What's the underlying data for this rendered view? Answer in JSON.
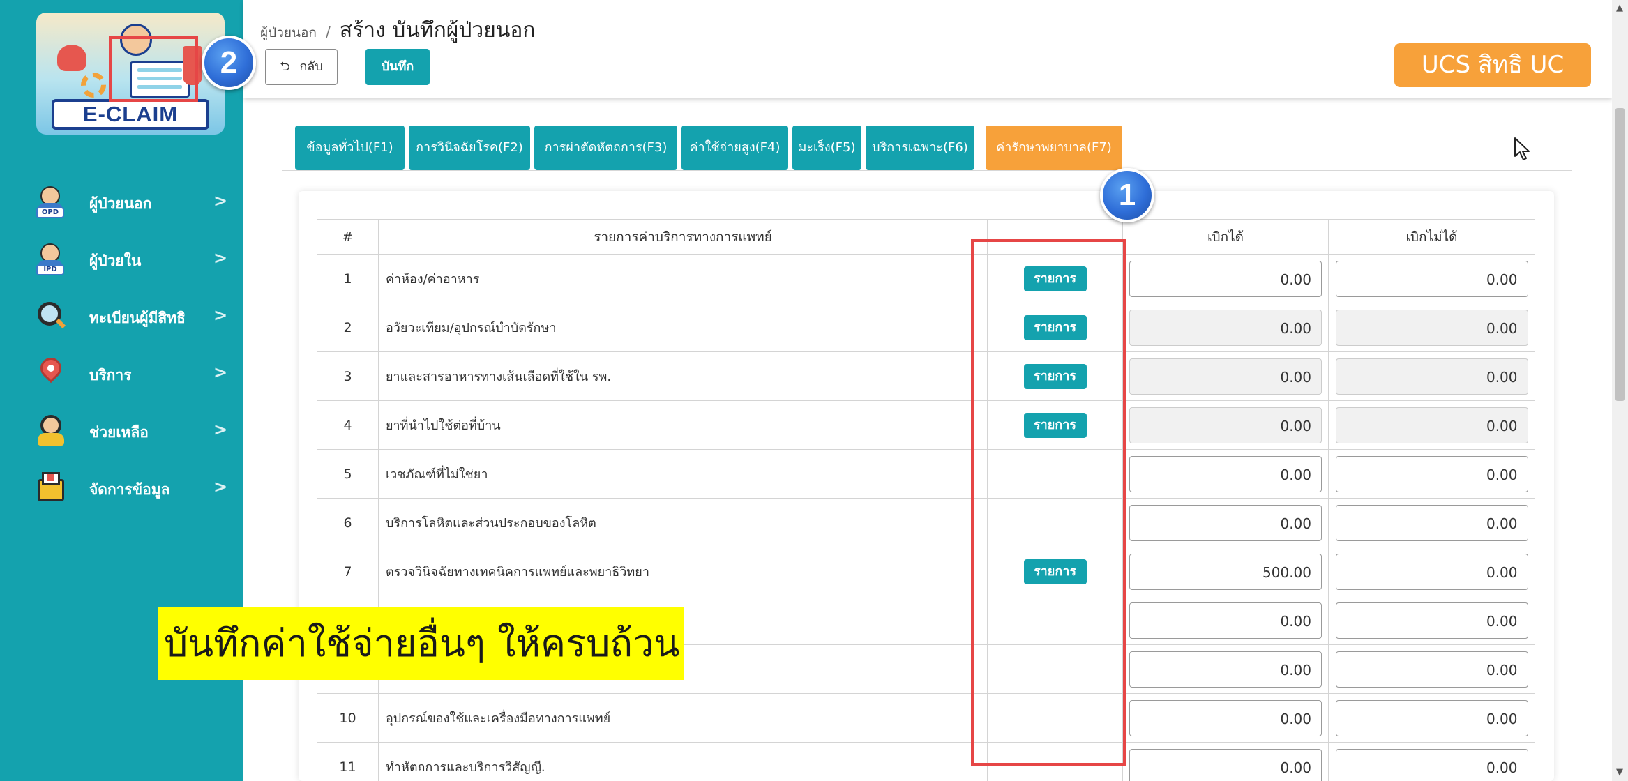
{
  "app": {
    "logo_text": "E-CLAIM"
  },
  "sidebar": {
    "items": [
      {
        "label": "ผู้ป่วยนอก",
        "icon": "opd-patient-icon",
        "icon_tag": "OPD"
      },
      {
        "label": "ผู้ป่วยใน",
        "icon": "ipd-patient-icon",
        "icon_tag": "IPD"
      },
      {
        "label": "ทะเบียนผู้มีสิทธิ",
        "icon": "registry-search-icon"
      },
      {
        "label": "บริการ",
        "icon": "location-pin-icon"
      },
      {
        "label": "ช่วยเหลือ",
        "icon": "support-agent-icon"
      },
      {
        "label": "จัดการข้อมูล",
        "icon": "data-manage-icon"
      }
    ],
    "chevron": ">"
  },
  "header": {
    "breadcrumb_parent": "ผู้ป่วยนอก",
    "breadcrumb_sep": "/",
    "title": "สร้าง บันทึกผู้ป่วยนอก",
    "back_label": "กลับ",
    "save_label": "บันทึก",
    "right_label": "UCS สิทธิ UC"
  },
  "tabs": [
    {
      "label": "ข้อมูลทั่วไป(F1)",
      "active": false
    },
    {
      "label": "การวินิจฉัยโรค(F2)",
      "active": false
    },
    {
      "label": "การผ่าตัดหัตถการ(F3)",
      "active": false
    },
    {
      "label": "ค่าใช้จ่ายสูง(F4)",
      "active": false
    },
    {
      "label": "มะเร็ง(F5)",
      "active": false
    },
    {
      "label": "บริการเฉพาะ(F6)",
      "active": false
    },
    {
      "label": "ค่ารักษาพยาบาล(F7)",
      "active": true
    }
  ],
  "table": {
    "headers": [
      "#",
      "รายการค่าบริการทางการแพทย์",
      "",
      "เบิกได้",
      "เบิกไม่ได้"
    ],
    "rows": [
      {
        "no": "1",
        "name": "ค่าห้อง/ค่าอาหาร",
        "button": "รายการ",
        "claimable": "0.00",
        "non_claimable": "0.00",
        "readonly": false
      },
      {
        "no": "2",
        "name": "อวัยวะเทียม/อุปกรณ์บำบัดรักษา",
        "button": "รายการ",
        "claimable": "0.00",
        "non_claimable": "0.00",
        "readonly": true
      },
      {
        "no": "3",
        "name": "ยาและสารอาหารทางเส้นเลือดที่ใช้ใน รพ.",
        "button": "รายการ",
        "claimable": "0.00",
        "non_claimable": "0.00",
        "readonly": true
      },
      {
        "no": "4",
        "name": "ยาที่นำไปใช้ต่อที่บ้าน",
        "button": "รายการ",
        "claimable": "0.00",
        "non_claimable": "0.00",
        "readonly": true
      },
      {
        "no": "5",
        "name": "เวชภัณฑ์ที่ไม่ใช่ยา",
        "button": "",
        "claimable": "0.00",
        "non_claimable": "0.00",
        "readonly": false
      },
      {
        "no": "6",
        "name": "บริการโลหิตและส่วนประกอบของโลหิต",
        "button": "",
        "claimable": "0.00",
        "non_claimable": "0.00",
        "readonly": false
      },
      {
        "no": "7",
        "name": "ตรวจวินิจฉัยทางเทคนิคการแพทย์และพยาธิวิทยา",
        "button": "รายการ",
        "claimable": "500.00",
        "non_claimable": "0.00",
        "readonly": false
      },
      {
        "no": "",
        "name": "",
        "button": "",
        "claimable": "0.00",
        "non_claimable": "0.00",
        "readonly": false
      },
      {
        "no": "",
        "name": "",
        "button": "",
        "claimable": "0.00",
        "non_claimable": "0.00",
        "readonly": false
      },
      {
        "no": "10",
        "name": "อุปกรณ์ของใช้และเครื่องมือทางการแพทย์",
        "button": "",
        "claimable": "0.00",
        "non_claimable": "0.00",
        "readonly": false
      },
      {
        "no": "11",
        "name": "ทำหัตถการและบริการวิสัญญี.",
        "button": "",
        "claimable": "0.00",
        "non_claimable": "0.00",
        "readonly": false
      }
    ]
  },
  "annotations": {
    "callout": "บันทึกค่าใช้จ่ายอื่นๆ ให้ครบถ้วน",
    "badge_1": "1",
    "badge_2": "2",
    "highlight_color": "#e64646",
    "callout_bg": "#ffff00"
  },
  "colors": {
    "primary": "#14a2ae",
    "active_tab": "#f7a13a",
    "right_badge": "#f7a13a"
  }
}
